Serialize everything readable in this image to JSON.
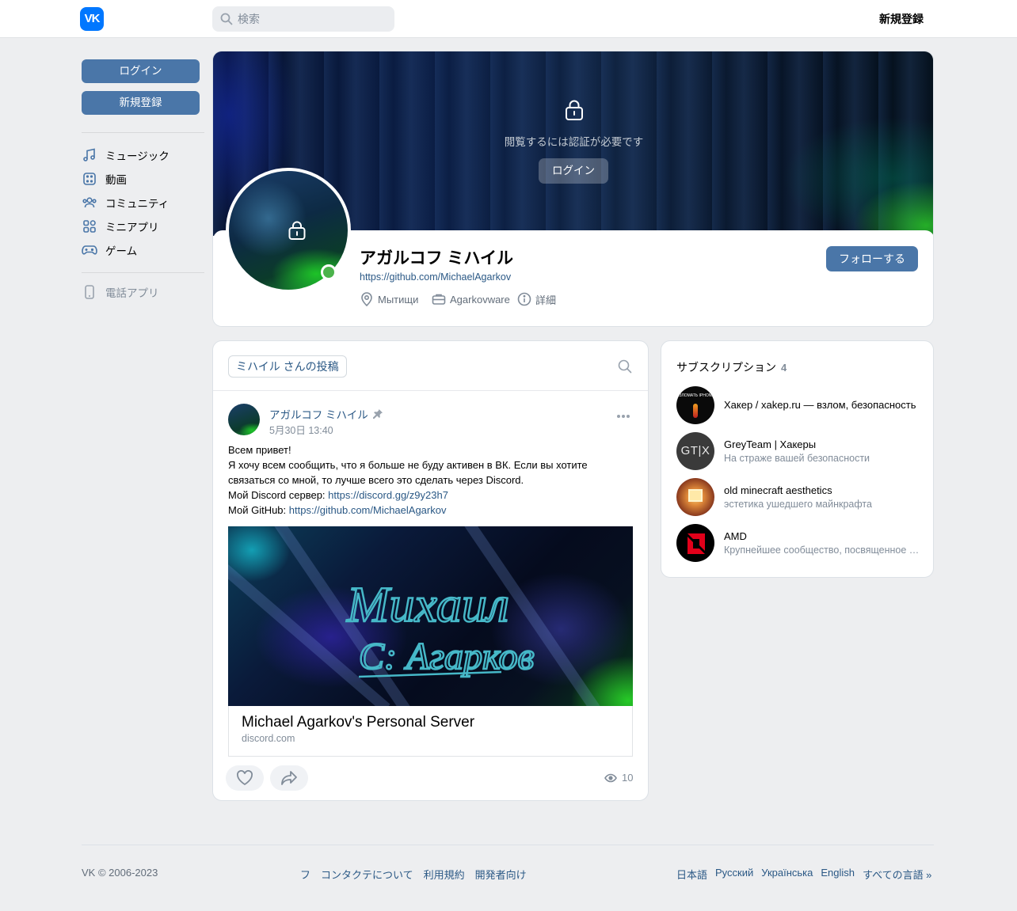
{
  "header": {
    "logo_text": "VK",
    "search_placeholder": "検索",
    "register_label": "新規登録"
  },
  "sidebar": {
    "login_label": "ログイン",
    "register_label": "新規登録",
    "items": [
      {
        "label": "ミュージック",
        "icon": "music-icon"
      },
      {
        "label": "動画",
        "icon": "video-icon"
      },
      {
        "label": "コミュニティ",
        "icon": "community-icon"
      },
      {
        "label": "ミニアプリ",
        "icon": "mini-apps-icon"
      },
      {
        "label": "ゲーム",
        "icon": "gamepad-icon"
      }
    ],
    "phone_app_label": "電話アプリ"
  },
  "profile": {
    "cover_text": "閲覧するには認証が必要です",
    "cover_login_label": "ログイン",
    "name": "アガルコフ ミハイル",
    "link": "https://github.com/MichaelAgarkov",
    "location": "Мытищи",
    "work": "Agarkovware",
    "details_label": "詳細",
    "follow_label": "フォローする",
    "online": true
  },
  "wall": {
    "tab_label": "ミハイル さんの投稿",
    "post": {
      "author": "アガルコフ ミハイル",
      "date": "5月30日 13:40",
      "line1": "Всем привет!",
      "line2": "Я хочу всем сообщить, что я больше не буду активен в ВК. Если вы хотите",
      "line3": "связаться со мной, то лучше всего это сделать через Discord.",
      "discord_prefix": "Мой Discord сервер: ",
      "discord_link": "https://discord.gg/z9y23h7",
      "github_prefix": "Мой GitHub: ",
      "github_link": "https://github.com/MichaelAgarkov",
      "image_signature_line1": "Михаил",
      "image_signature_line2": "С: Агарков",
      "link_title": "Michael Agarkov's Personal Server",
      "link_domain": "discord.com",
      "views": "10"
    }
  },
  "subscriptions": {
    "title": "サブスクリプション",
    "count": "4",
    "items": [
      {
        "name": "Хакер / xakep.ru — взлом, безопасность",
        "desc": "",
        "avatar_text": "ВЗЛОМАТЬ IPHONE"
      },
      {
        "name": "GreyTeam | Хакеры",
        "desc": "На страже вашей безопасности",
        "avatar_text": "GT|X"
      },
      {
        "name": "old minecraft aesthetics",
        "desc": "эстетика ушедшего майнкрафта",
        "avatar_text": ""
      },
      {
        "name": "AMD",
        "desc": "Крупнейшее сообщество, посвященное компании AMD",
        "avatar_text": ""
      }
    ]
  },
  "footer": {
    "copyright": "VK © 2006-2023",
    "links": [
      "フ",
      "コンタクテについて",
      "利用規約",
      "開発者向け"
    ],
    "languages": [
      "日本語",
      "Русский",
      "Українська",
      "English",
      "すべての言語 »"
    ]
  },
  "colors": {
    "accent": "#4a76a8",
    "link": "#2a5885",
    "background": "#edeef0",
    "online": "#4bb34b"
  }
}
